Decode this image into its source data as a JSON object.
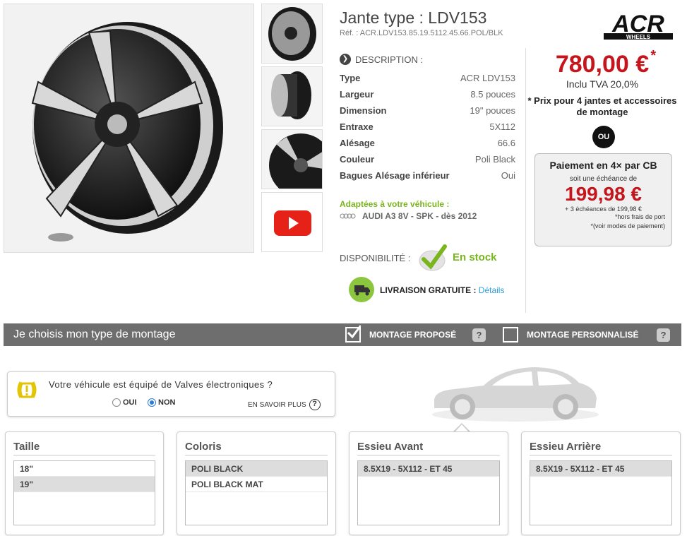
{
  "product": {
    "title": "Jante type : LDV153",
    "ref": "Réf. : ACR.LDV153.85.19.5112.45.66.POL/BLK",
    "logo_brand": "ACR",
    "logo_sub": "WHEELS"
  },
  "description": {
    "heading": "DESCRIPTION :",
    "specs": [
      {
        "label": "Type",
        "value": "ACR LDV153"
      },
      {
        "label": "Largeur",
        "value": "8.5 pouces"
      },
      {
        "label": "Dimension",
        "value": "19\" pouces"
      },
      {
        "label": "Entraxe",
        "value": "5X112"
      },
      {
        "label": "Alésage",
        "value": "66.6"
      },
      {
        "label": "Couleur",
        "value": "Poli Black"
      },
      {
        "label": "Bagues Alésage inférieur",
        "value": "Oui"
      }
    ],
    "adapted_label": "Adaptées à votre véhicule :",
    "vehicle": "AUDI A3 8V - SPK - dès 2012",
    "availability_label": "DISPONIBILITÉ :",
    "availability_value": "En stock",
    "delivery_label": "LIVRAISON GRATUITE :",
    "delivery_link": "Détails"
  },
  "price": {
    "amount": "780,00 €",
    "asterisk": "*",
    "tva": "Inclu TVA 20,0%",
    "note": "* Prix pour 4 jantes et accessoires de montage",
    "or": "OU",
    "installment_title": "Paiement en 4× par CB",
    "installment_sub": "soit une échéance de",
    "installment_value": "199,98 €",
    "installment_more": "+ 3 échéances de 199,98 €",
    "installment_fee": "*hors frais de port",
    "installment_modes": "*(voir modes de paiement)"
  },
  "montage": {
    "title": "Je choisis mon type de montage",
    "option1": "MONTAGE PROPOSÉ",
    "option2": "MONTAGE PERSONNALISÉ",
    "help": "?"
  },
  "valves": {
    "question": "Votre véhicule est équipé de Valves électroniques ?",
    "yes": "OUI",
    "no": "NON",
    "more": "EN SAVOIR PLUS",
    "help": "?"
  },
  "panels": {
    "taille": {
      "title": "Taille",
      "options": [
        "18\"",
        "19\""
      ]
    },
    "coloris": {
      "title": "Coloris",
      "options": [
        "POLI BLACK",
        "POLI BLACK MAT"
      ]
    },
    "essieu_avant": {
      "title": "Essieu Avant",
      "options": [
        "8.5X19 - 5X112 - ET 45"
      ]
    },
    "essieu_arriere": {
      "title": "Essieu Arrière",
      "options": [
        "8.5X19 - 5X112 - ET 45"
      ]
    }
  },
  "colors": {
    "price_red": "#c4161c",
    "green": "#7ab51d",
    "link_blue": "#2b9fd6",
    "bar_grey": "#6e6e6e"
  }
}
